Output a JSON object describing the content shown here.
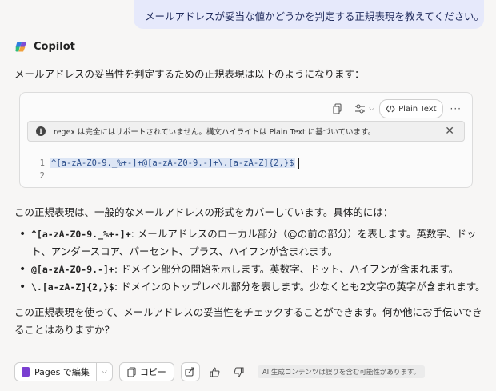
{
  "user_message": "メールアドレスが妥当な値かどうかを判定する正規表現を教えてください。",
  "assistant": {
    "name": "Copilot",
    "intro": "メールアドレスの妥当性を判定するための正規表現は以下のようになります：",
    "code_block": {
      "language_label": "Plain Text",
      "notice": "regex は完全にはサポートされていません。構文ハイライトは Plain Text に基づいています。",
      "lines": [
        {
          "number": "1",
          "text": "^[a-zA-Z0-9._%+-]+@[a-zA-Z0-9.-]+\\.[a-zA-Z]{2,}$"
        },
        {
          "number": "2",
          "text": ""
        }
      ]
    },
    "explain": "この正規表現は、一般的なメールアドレスの形式をカバーしています。具体的には：",
    "bullets": [
      {
        "code": "^[a-zA-Z0-9._%+-]+",
        "text": ": メールアドレスのローカル部分（@の前の部分）を表します。英数字、ドット、アンダースコア、パーセント、プラス、ハイフンが含まれます。"
      },
      {
        "code": "@[a-zA-Z0-9.-]+",
        "text": ": ドメイン部分の開始を示します。英数字、ドット、ハイフンが含まれます。"
      },
      {
        "code": "\\.[a-zA-Z]{2,}$",
        "text": ": ドメインのトップレベル部分を表します。少なくとも2文字の英字が含まれます。"
      }
    ],
    "closing": "この正規表現を使って、メールアドレスの妥当性をチェックすることができます。何か他にお手伝いできることはありますか？"
  },
  "actions": {
    "pages_label": "Pages で編集",
    "copy_label": "コピー",
    "disclaimer": "AI 生成コンテンツは誤りを含む可能性があります。"
  },
  "icons": [
    "copilot-logo-icon",
    "copy-code-icon",
    "settings-sliders-icon",
    "code-icon",
    "more-icon",
    "info-icon",
    "close-icon",
    "pages-icon",
    "copy-icon",
    "share-icon",
    "thumbs-up-icon",
    "thumbs-down-icon"
  ],
  "colors": {
    "user_bubble": "#e6e9fb",
    "pages_accent": "#7a3fd1",
    "code_text": "#2a4d8a"
  }
}
